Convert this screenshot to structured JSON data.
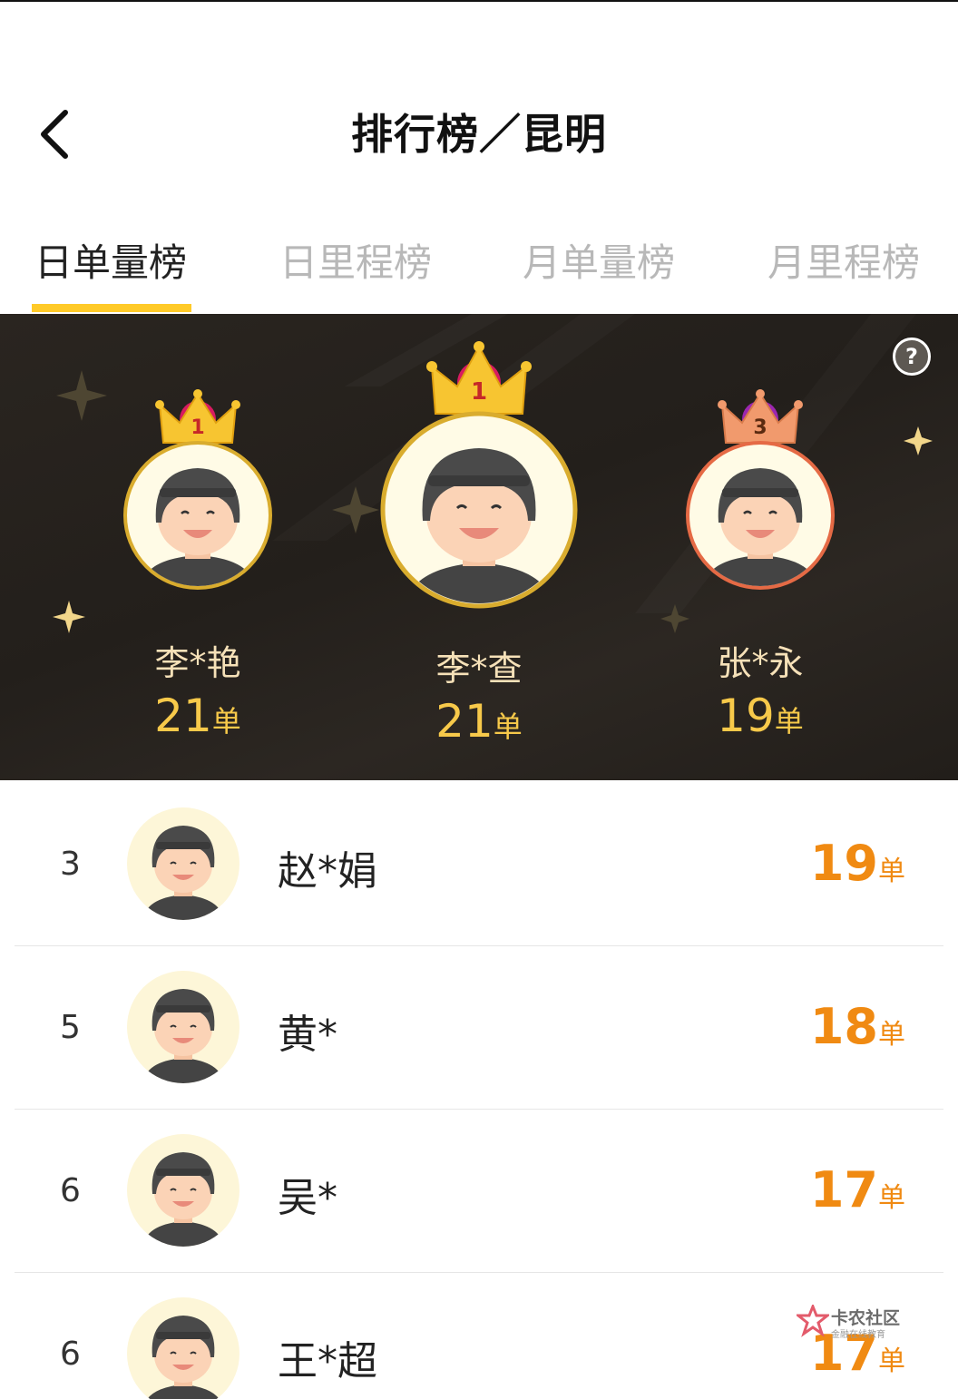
{
  "header": {
    "title": "排行榜／昆明"
  },
  "tabs": [
    {
      "label": "日单量榜",
      "active": true
    },
    {
      "label": "日里程榜",
      "active": false
    },
    {
      "label": "月单量榜",
      "active": false
    },
    {
      "label": "月里程榜",
      "active": false
    }
  ],
  "podium": {
    "help": "?",
    "left": {
      "crown_number": "1",
      "name": "李*艳",
      "score": "21",
      "unit": "单"
    },
    "center": {
      "crown_number": "1",
      "name": "李*查",
      "score": "21",
      "unit": "单"
    },
    "right": {
      "crown_number": "3",
      "name": "张*永",
      "score": "19",
      "unit": "单"
    }
  },
  "list": [
    {
      "rank": "3",
      "name": "赵*娟",
      "score": "19",
      "unit": "单"
    },
    {
      "rank": "5",
      "name": "黄*",
      "score": "18",
      "unit": "单"
    },
    {
      "rank": "6",
      "name": "吴*",
      "score": "17",
      "unit": "单"
    },
    {
      "rank": "6",
      "name": "王*超",
      "score": "17",
      "unit": "单"
    }
  ],
  "watermark": {
    "title": "卡农社区",
    "subtitle": "金融在线教育"
  },
  "colors": {
    "accent": "#ffca28",
    "score_orange": "#f08a12",
    "podium_bg": "#262220",
    "gold": "#f7c94a"
  }
}
